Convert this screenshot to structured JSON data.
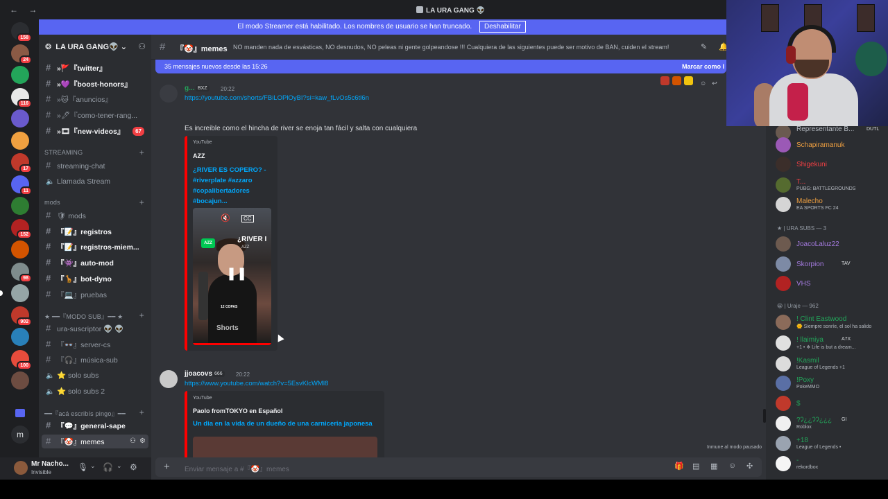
{
  "window": {
    "title": "LA URA GANG 👽",
    "nav_icons": "← →"
  },
  "banner": {
    "text": "El modo Streamer está habilitado. Los nombres de usuario se han truncado.",
    "button": "Deshabilitar"
  },
  "guilds": [
    {
      "color": "#2b2d31",
      "badge": "158"
    },
    {
      "color": "#8a5a45",
      "badge": "24"
    },
    {
      "color": "#23a55a",
      "badge": ""
    },
    {
      "color": "#e8e8e8",
      "badge": "116"
    },
    {
      "color": "#6a5acd",
      "badge": ""
    },
    {
      "color": "#f0a040",
      "badge": ""
    },
    {
      "color": "#c0392b",
      "badge": "17"
    },
    {
      "color": "#5865f2",
      "badge": "11"
    },
    {
      "color": "#2e7d32",
      "badge": ""
    },
    {
      "color": "#b22222",
      "badge": "152"
    },
    {
      "color": "#d35400",
      "badge": ""
    },
    {
      "color": "#7f8c8d",
      "badge": "98"
    },
    {
      "color": "#95a5a6",
      "badge": ""
    },
    {
      "color": "#c0392b",
      "badge": "902"
    },
    {
      "color": "#2980b9",
      "badge": ""
    },
    {
      "color": "#e74c3c",
      "badge": "100"
    },
    {
      "color": "#6d4c41",
      "badge": ""
    }
  ],
  "server": {
    "name": "LA URA GANG👽",
    "symbol": "❂"
  },
  "channels": [
    {
      "name": "»🚩『twitter』",
      "unread": true
    },
    {
      "name": "»💜『boost-honors』",
      "unread": true
    },
    {
      "name": "»🐱『anuncios』",
      "unread": false
    },
    {
      "name": "»🖊『como-tener-rang...",
      "unread": false
    },
    {
      "name": "»🎞『new-videos』",
      "unread": true,
      "badge": "67"
    }
  ],
  "cat_streaming": "STREAMING",
  "streaming_channels": [
    {
      "name": "streaming-chat",
      "type": "text"
    },
    {
      "name": "Llamada Stream",
      "type": "voice"
    }
  ],
  "cat_mods": "mods",
  "mods_channels": [
    {
      "name": "🛡 mods",
      "unread": false,
      "type": "text"
    },
    {
      "name": "『📝』registros",
      "unread": true,
      "type": "text"
    },
    {
      "name": "『📝』registros-miem...",
      "unread": true,
      "type": "text"
    },
    {
      "name": "『👾』auto-mod",
      "unread": true,
      "type": "text"
    },
    {
      "name": "『🦒』bot-dyno",
      "unread": true,
      "type": "text"
    },
    {
      "name": "『💻』pruebas",
      "unread": false,
      "type": "text"
    }
  ],
  "cat_subs": "★ ━━『MODO SUB』━━ ★",
  "subs_channels": [
    {
      "name": "ura-suscriptor 👽 👽",
      "type": "text"
    },
    {
      "name": "『👓』server-cs",
      "type": "text"
    },
    {
      "name": "『🎧』música-sub",
      "type": "text"
    },
    {
      "name": "⭐ solo subs",
      "type": "voice"
    },
    {
      "name": "⭐ solo subs 2",
      "type": "voice"
    }
  ],
  "cat_pingo": "━━『acá escribís pingo』━━",
  "pingo_channels": [
    {
      "name": "『💬』general-sape",
      "active": false
    },
    {
      "name": "『🤡』memes",
      "active": true
    }
  ],
  "user": {
    "name": "Mr Nacho...",
    "status": "Invisible"
  },
  "header": {
    "channel": "『🤡』memes",
    "topic": "NO manden nada de esvásticas, NO desnudos, NO peleas ni gente golpeandose !!! Cualquiera de las siguientes puede ser motivo de BAN, cuiden el stream!"
  },
  "newbar": {
    "text": "35 mensajes nuevos desde las 15:26",
    "mark": "Marcar como l"
  },
  "messages": [
    {
      "author": "g...",
      "tag": "BXZ",
      "time": "20:22",
      "author_color": "#23a55a",
      "link": "https://youtube.com/shorts/FBiLOPlOyBI?si=kaw_fLvOs5c6tl6n",
      "text": "Es increible como el hincha de river se enoja tan fácil y salta con cualquiera",
      "embed": {
        "provider": "YouTube",
        "author": "AZZ",
        "title_lines": [
          "¿RIVER ES COPERO? -",
          "#riverplate #azzaro",
          "#copalibertadores",
          "#bocajun..."
        ],
        "video_title": "¿RIVER I",
        "video_sub": "AZZ",
        "video_copas": "12 COPAS",
        "video_watermark": "Shorts"
      }
    },
    {
      "author": "jjoacovs",
      "tag": "666",
      "time": "20:22",
      "author_color": "#f2f3f5",
      "link": "https://www.youtube.com/watch?v=5EsvKlcWMl8",
      "embed": {
        "provider": "YouTube",
        "author": "Paolo fromTOKYO en Español",
        "title": "Un dia en la vida de un dueño de una carniceria japonesa"
      }
    }
  ],
  "immune": "Inmune al modo pausado",
  "composer": {
    "placeholder": "Enviar mensaje a #『🤡』memes"
  },
  "members_partial": {
    "name": "Representante B...",
    "tag": "DUTL"
  },
  "members_top": [
    {
      "name": "Schapiramanuk",
      "color": "#f0a040",
      "activity": "",
      "av": "#9b59b6"
    },
    {
      "name": "Shigekuni",
      "color": "#f23f43",
      "activity": "",
      "av": "#3b2e2a"
    },
    {
      "name": "T...",
      "color": "#f23f43",
      "activity": "PUBG: BATTLEGROUNDS",
      "av": "#556b2f"
    },
    {
      "name": "Malecho",
      "color": "#f0a040",
      "activity": "EA SPORTS FC 24",
      "av": "#d5d5d5"
    }
  ],
  "group_subs": "★ | URA SUBS — 3",
  "members_subs": [
    {
      "name": "JoacoLaluz22",
      "color": "#a57be0",
      "activity": "",
      "av": "#6d5a4f",
      "tag": ""
    },
    {
      "name": "Skorpion",
      "color": "#a57be0",
      "activity": "",
      "av": "#7d8aa5",
      "tag": "TAV"
    },
    {
      "name": "VHS",
      "color": "#a57be0",
      "activity": "",
      "av": "#b22222",
      "tag": ""
    }
  ],
  "group_uraje": "😀 | Uraje — 962",
  "members_uraje": [
    {
      "name": "! Clint Eastwood",
      "color": "#23a55a",
      "activity": "🌞 Siempre sonríe, el sol ha salido",
      "av": "#8b6b5a",
      "tag": ""
    },
    {
      "name": "! llaimiya",
      "color": "#23a55a",
      "activity": "+1 • ❄ Life is but a dream...",
      "av": "#e0e0e0",
      "tag": "A7X"
    },
    {
      "name": "!Kasmil",
      "color": "#23a55a",
      "activity": "League of Legends +1",
      "av": "#dcdcdc",
      "tag": ""
    },
    {
      "name": "!Poxy",
      "color": "#23a55a",
      "activity": "PokeMMO",
      "av": "#5a6fa5",
      "tag": ""
    },
    {
      "name": "$",
      "color": "#23a55a",
      "activity": "",
      "av": "#c0392b",
      "tag": ""
    },
    {
      "name": "?ʔ¿¿ʔʔ¿¿¿",
      "color": "#23a55a",
      "activity": "Roblox",
      "av": "#f0f0f0",
      "tag": "GI"
    },
    {
      "name": "+18",
      "color": "#23a55a",
      "activity": "League of Legends •",
      "av": "#9aa3b0",
      "tag": ""
    },
    {
      "name": "-",
      "color": "#23a55a",
      "activity": "rekordbox",
      "av": "#f5f5f5",
      "tag": ""
    }
  ]
}
